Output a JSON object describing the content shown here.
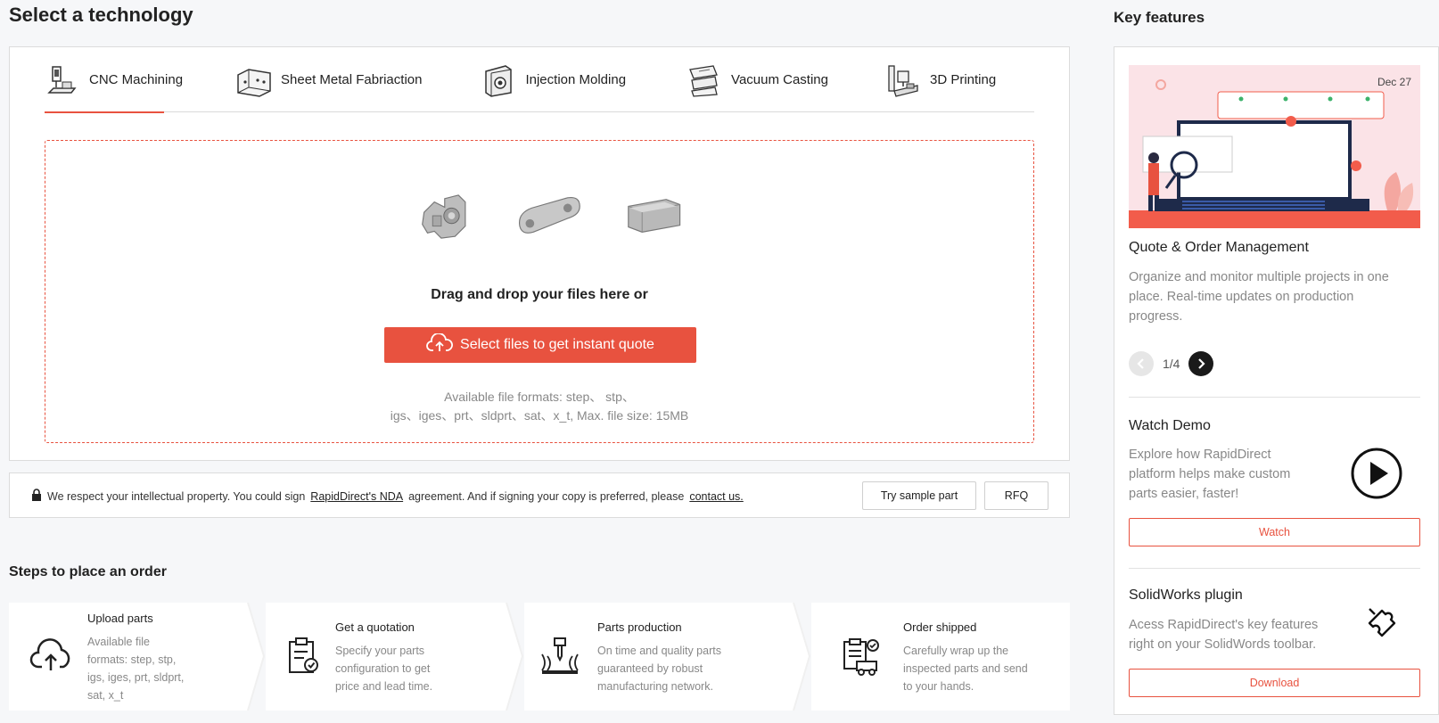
{
  "header": {
    "title": "Select a technology",
    "key_features_title": "Key features"
  },
  "tabs": [
    {
      "label": "CNC Machining",
      "icon": "cnc-machine-icon",
      "active": true
    },
    {
      "label": "Sheet Metal Fabriaction",
      "icon": "sheet-metal-icon",
      "active": false
    },
    {
      "label": "Injection Molding",
      "icon": "injection-mold-icon",
      "active": false
    },
    {
      "label": "Vacuum Casting",
      "icon": "vacuum-casting-icon",
      "active": false
    },
    {
      "label": "3D Printing",
      "icon": "3d-printer-icon",
      "active": false
    }
  ],
  "upload": {
    "drag_text": "Drag and drop your files here or",
    "button_label": "Select files to get instant quote",
    "formats_line1": "Available file formats: step、 stp、",
    "formats_line2": "igs、iges、prt、sldprt、sat、x_t, Max. file size: 15MB"
  },
  "nda": {
    "text_before": "We respect your intellectual property. You could sign",
    "nda_link": "RapidDirect's NDA",
    "text_middle": "agreement. And if signing your copy is preferred, please",
    "contact_link": "contact us.",
    "sample_button": "Try sample part",
    "rfq_button": "RFQ"
  },
  "steps": {
    "title": "Steps to place an order",
    "items": [
      {
        "name": "Upload parts",
        "icon": "cloud-upload-icon",
        "desc": [
          "Available file",
          "formats: step, stp,",
          "igs, iges, prt, sldprt,",
          "sat, x_t"
        ]
      },
      {
        "name": "Get a quotation",
        "icon": "clipboard-check-icon",
        "desc": [
          "Specify your parts",
          "configuration to get",
          "price and lead time."
        ]
      },
      {
        "name": "Parts production",
        "icon": "milling-icon",
        "desc": [
          "On time and quality parts",
          "guaranteed by robust",
          "manufacturing network."
        ]
      },
      {
        "name": "Order shipped",
        "icon": "shipping-icon",
        "desc": [
          "Carefully wrap up the",
          "inspected parts and send",
          "to your hands."
        ]
      }
    ]
  },
  "key_features": {
    "image_date": "Dec 27",
    "quote_title": "Quote & Order Management",
    "quote_desc": [
      "Organize and monitor multiple projects in one",
      "place. Real-time updates on production",
      "progress."
    ],
    "pager": "1/4",
    "demo_title": "Watch Demo",
    "demo_desc": [
      "Explore how RapidDirect",
      "platform helps make custom",
      "parts easier, faster!"
    ],
    "watch_button": "Watch",
    "plugin_title": "SolidWorks plugin",
    "plugin_desc": [
      "Acess RapidDirect's key features",
      "right on your SolidWords toolbar."
    ],
    "download_button": "Download"
  },
  "colors": {
    "accent": "#e8523f",
    "background": "#f6f7f9"
  }
}
